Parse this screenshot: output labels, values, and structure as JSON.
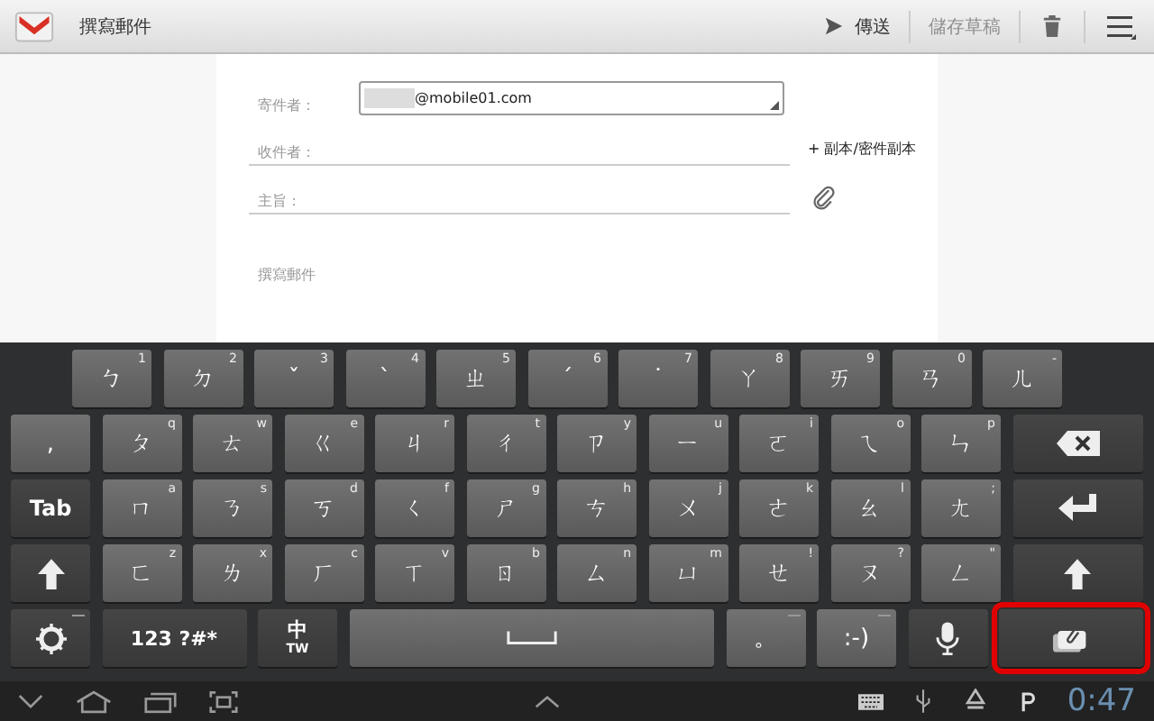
{
  "top_bar": {
    "title": "撰寫郵件",
    "actions": [
      {
        "kind": "send",
        "label": "傳送",
        "disabled": false
      },
      {
        "kind": "save",
        "label": "儲存草稿",
        "disabled": true
      },
      {
        "kind": "trash"
      },
      {
        "kind": "menu"
      }
    ]
  },
  "compose": {
    "from": {
      "label": "寄件者：",
      "value": "@mobile01.com"
    },
    "to": {
      "placeholder": "收件者："
    },
    "cc_link": "+ 副本/密件副本",
    "subject": {
      "placeholder": "主旨："
    },
    "body": {
      "placeholder": "撰寫郵件"
    }
  },
  "keyboard": {
    "rows": [
      [
        {
          "kind": "char",
          "label": "ㄅ",
          "hint": "1"
        },
        {
          "kind": "char",
          "label": "ㄉ",
          "hint": "2"
        },
        {
          "kind": "char",
          "label": "ˇ",
          "hint": "3"
        },
        {
          "kind": "char",
          "label": "ˋ",
          "hint": "4"
        },
        {
          "kind": "char",
          "label": "ㄓ",
          "hint": "5"
        },
        {
          "kind": "char",
          "label": "ˊ",
          "hint": "6"
        },
        {
          "kind": "char",
          "label": "˙",
          "hint": "7"
        },
        {
          "kind": "char",
          "label": "ㄚ",
          "hint": "8"
        },
        {
          "kind": "char",
          "label": "ㄞ",
          "hint": "9"
        },
        {
          "kind": "char",
          "label": "ㄢ",
          "hint": "0"
        },
        {
          "kind": "char",
          "label": "ㄦ",
          "hint": "-"
        }
      ],
      [
        {
          "kind": "char",
          "label": ","
        },
        {
          "kind": "char",
          "label": "ㄆ",
          "hint": "q"
        },
        {
          "kind": "char",
          "label": "ㄊ",
          "hint": "w"
        },
        {
          "kind": "char",
          "label": "ㄍ",
          "hint": "e"
        },
        {
          "kind": "char",
          "label": "ㄐ",
          "hint": "r"
        },
        {
          "kind": "char",
          "label": "ㄔ",
          "hint": "t"
        },
        {
          "kind": "char",
          "label": "ㄗ",
          "hint": "y"
        },
        {
          "kind": "char",
          "label": "ㄧ",
          "hint": "u"
        },
        {
          "kind": "char",
          "label": "ㄛ",
          "hint": "i"
        },
        {
          "kind": "char",
          "label": "ㄟ",
          "hint": "o"
        },
        {
          "kind": "char",
          "label": "ㄣ",
          "hint": "p"
        },
        {
          "kind": "backspace"
        }
      ],
      [
        {
          "kind": "tab",
          "label": "Tab"
        },
        {
          "kind": "char",
          "label": "ㄇ",
          "hint": "a"
        },
        {
          "kind": "char",
          "label": "ㄋ",
          "hint": "s"
        },
        {
          "kind": "char",
          "label": "ㄎ",
          "hint": "d"
        },
        {
          "kind": "char",
          "label": "ㄑ",
          "hint": "f"
        },
        {
          "kind": "char",
          "label": "ㄕ",
          "hint": "g"
        },
        {
          "kind": "char",
          "label": "ㄘ",
          "hint": "h"
        },
        {
          "kind": "char",
          "label": "ㄨ",
          "hint": "j"
        },
        {
          "kind": "char",
          "label": "ㄜ",
          "hint": "k"
        },
        {
          "kind": "char",
          "label": "ㄠ",
          "hint": "l"
        },
        {
          "kind": "char",
          "label": "ㄤ",
          "hint": ";"
        },
        {
          "kind": "enter"
        }
      ],
      [
        {
          "kind": "shift"
        },
        {
          "kind": "char",
          "label": "ㄈ",
          "hint": "z"
        },
        {
          "kind": "char",
          "label": "ㄌ",
          "hint": "x"
        },
        {
          "kind": "char",
          "label": "ㄏ",
          "hint": "c"
        },
        {
          "kind": "char",
          "label": "ㄒ",
          "hint": "v"
        },
        {
          "kind": "char",
          "label": "ㄖ",
          "hint": "b"
        },
        {
          "kind": "char",
          "label": "ㄙ",
          "hint": "n"
        },
        {
          "kind": "char",
          "label": "ㄩ",
          "hint": "m"
        },
        {
          "kind": "char",
          "label": "ㄝ",
          "hint": "!"
        },
        {
          "kind": "char",
          "label": "ㄡ",
          "hint": "?"
        },
        {
          "kind": "char",
          "label": "ㄥ",
          "hint": "\""
        },
        {
          "kind": "shift"
        }
      ],
      [
        {
          "kind": "settings",
          "more": true
        },
        {
          "kind": "symbols",
          "label": "123 ?#*"
        },
        {
          "kind": "lang",
          "label": "中",
          "sub": "TW"
        },
        {
          "kind": "space"
        },
        {
          "kind": "char",
          "label": "。",
          "more": true
        },
        {
          "kind": "char",
          "label": ":-)",
          "more": true
        },
        {
          "kind": "mic"
        },
        {
          "kind": "attach",
          "highlighted": true
        }
      ]
    ]
  },
  "nav_bar": {
    "clock": "0:47"
  }
}
